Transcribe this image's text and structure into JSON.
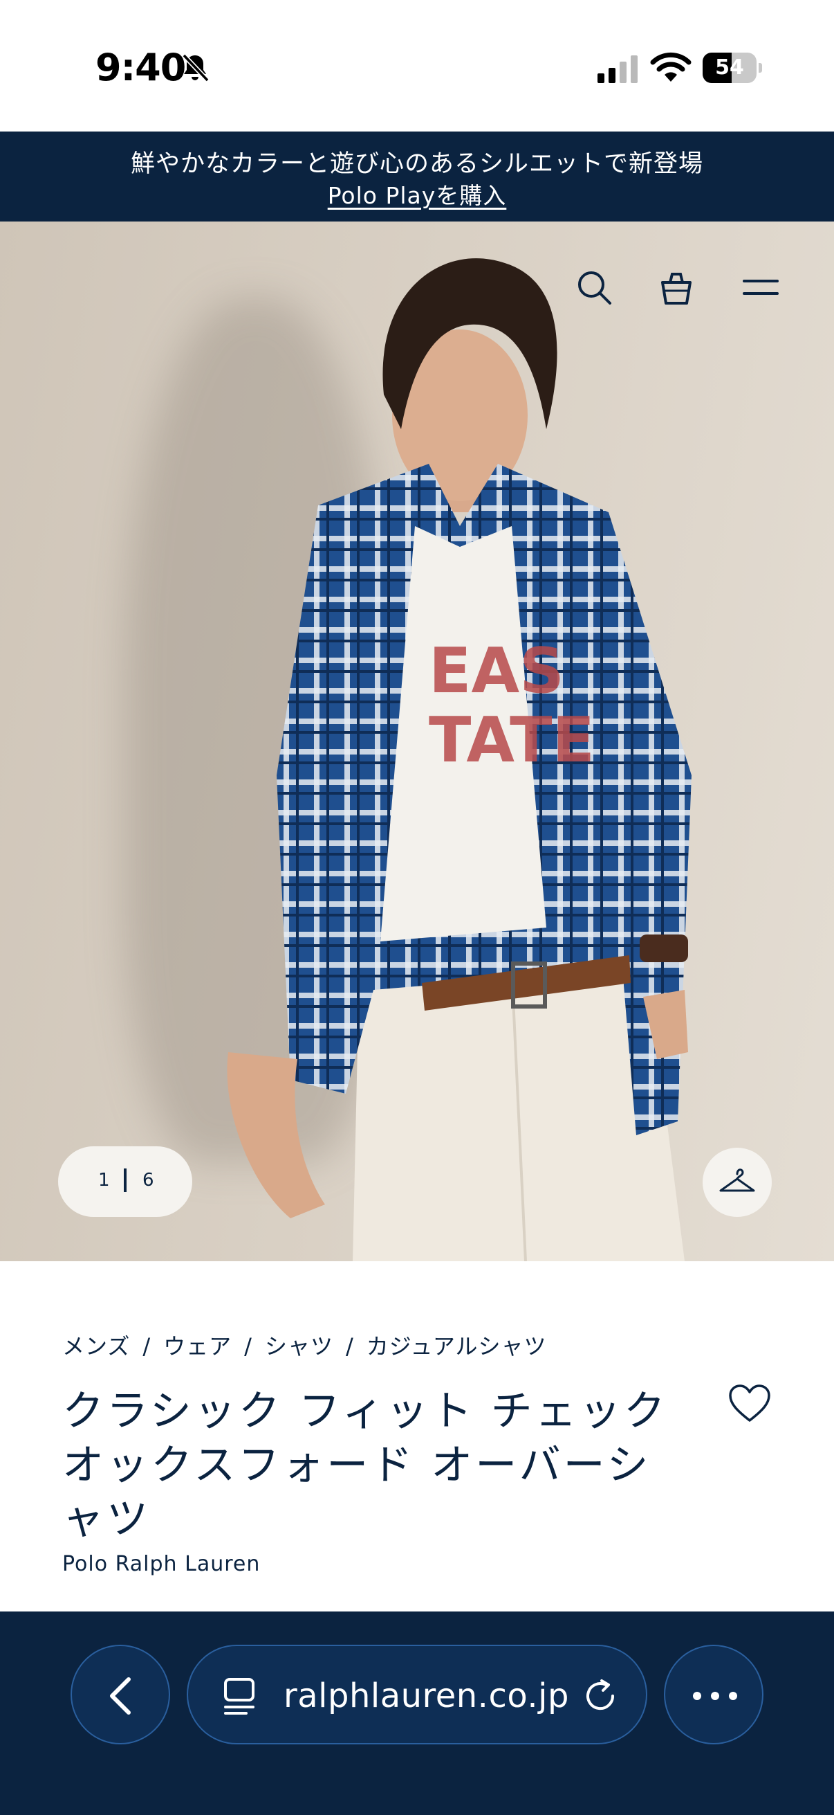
{
  "status_bar": {
    "time": "9:40",
    "battery_level": "54",
    "battery_fraction": 0.54
  },
  "promo": {
    "text": "鮮やかなカラーと遊び心のあるシルエットで新登場",
    "link_label": "Polo Playを購入"
  },
  "header": {
    "icons": [
      "search-icon",
      "shopping-bag-icon",
      "menu-icon"
    ]
  },
  "gallery": {
    "current": "1",
    "total": "6"
  },
  "product": {
    "breadcrumb": [
      "メンズ",
      "ウェア",
      "シャツ",
      "カジュアルシャツ"
    ],
    "breadcrumb_separator": "/",
    "title": "クラシック フィット チェック オックスフォード オーバーシャツ",
    "brand": "Polo Ralph Lauren"
  },
  "browser": {
    "url": "ralphlauren.co.jp"
  },
  "colors": {
    "navy": "#0b2340",
    "browser_button": "#0e2e55",
    "browser_border": "#2a5f9e",
    "hero_background": "#d9d0c4"
  }
}
